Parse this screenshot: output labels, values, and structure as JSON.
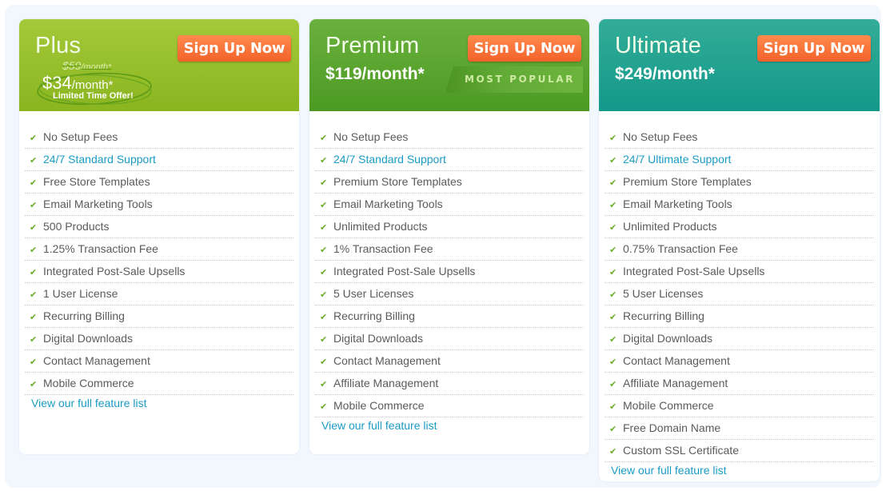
{
  "colors": {
    "plus_header": "#96bf2c",
    "premium_header": "#5aa530",
    "ultimate_header": "#20a191",
    "signup_button": "#f6703a",
    "link": "#1b9bc4",
    "check": "#6aab2c"
  },
  "plans": [
    {
      "name": "Plus",
      "signup_label": "Sign Up Now",
      "old_price": "$59",
      "old_price_suffix": "/month*",
      "price_amount": "$34",
      "price_suffix": "/month*",
      "promo_note": "Limited Time Offer!",
      "features": [
        {
          "icon": "check-icon",
          "label": "No Setup Fees"
        },
        {
          "icon": "check-icon",
          "label": "24/7 Standard Support",
          "highlight": true
        },
        {
          "icon": "check-icon",
          "label": "Free Store Templates"
        },
        {
          "icon": "check-icon",
          "label": "Email Marketing Tools"
        },
        {
          "icon": "check-icon",
          "label": "500 Products"
        },
        {
          "icon": "check-icon",
          "label": "1.25% Transaction Fee"
        },
        {
          "icon": "check-icon",
          "label": "Integrated Post-Sale Upsells"
        },
        {
          "icon": "check-icon",
          "label": "1 User License"
        },
        {
          "icon": "check-icon",
          "label": "Recurring Billing"
        },
        {
          "icon": "check-icon",
          "label": "Digital Downloads"
        },
        {
          "icon": "check-icon",
          "label": "Contact Management"
        },
        {
          "icon": "check-icon",
          "label": "Mobile Commerce"
        }
      ],
      "full_list_link": "View our full feature list"
    },
    {
      "name": "Premium",
      "signup_label": "Sign Up Now",
      "price": "$119/month*",
      "badge": "MOST POPULAR",
      "features": [
        {
          "icon": "check-icon",
          "label": "No Setup Fees"
        },
        {
          "icon": "check-icon",
          "label": "24/7 Standard Support",
          "highlight": true
        },
        {
          "icon": "check-icon",
          "label": "Premium Store Templates"
        },
        {
          "icon": "check-icon",
          "label": "Email Marketing Tools"
        },
        {
          "icon": "check-icon",
          "label": "Unlimited Products"
        },
        {
          "icon": "check-icon",
          "label": "1% Transaction Fee"
        },
        {
          "icon": "check-icon",
          "label": "Integrated Post-Sale Upsells"
        },
        {
          "icon": "check-icon",
          "label": "5 User Licenses"
        },
        {
          "icon": "check-icon",
          "label": "Recurring Billing"
        },
        {
          "icon": "check-icon",
          "label": "Digital Downloads"
        },
        {
          "icon": "check-icon",
          "label": "Contact Management"
        },
        {
          "icon": "check-icon",
          "label": "Affiliate Management"
        },
        {
          "icon": "check-icon",
          "label": "Mobile Commerce"
        }
      ],
      "full_list_link": "View our full feature list"
    },
    {
      "name": "Ultimate",
      "signup_label": "Sign Up Now",
      "price": "$249/month*",
      "features": [
        {
          "icon": "check-icon",
          "label": "No Setup Fees"
        },
        {
          "icon": "check-icon",
          "label": "24/7 Ultimate Support",
          "highlight": true
        },
        {
          "icon": "check-icon",
          "label": "Premium Store Templates"
        },
        {
          "icon": "check-icon",
          "label": "Email Marketing Tools"
        },
        {
          "icon": "check-icon",
          "label": "Unlimited Products"
        },
        {
          "icon": "check-icon",
          "label": "0.75% Transaction Fee"
        },
        {
          "icon": "check-icon",
          "label": "Integrated Post-Sale Upsells"
        },
        {
          "icon": "check-icon",
          "label": "5 User Licenses"
        },
        {
          "icon": "check-icon",
          "label": "Recurring Billing"
        },
        {
          "icon": "check-icon",
          "label": "Digital Downloads"
        },
        {
          "icon": "check-icon",
          "label": "Contact Management"
        },
        {
          "icon": "check-icon",
          "label": "Affiliate Management"
        },
        {
          "icon": "check-icon",
          "label": "Mobile Commerce"
        },
        {
          "icon": "check-icon",
          "label": "Free Domain Name"
        },
        {
          "icon": "check-icon",
          "label": "Custom SSL Certificate"
        }
      ],
      "full_list_link": "View our full feature list"
    }
  ]
}
